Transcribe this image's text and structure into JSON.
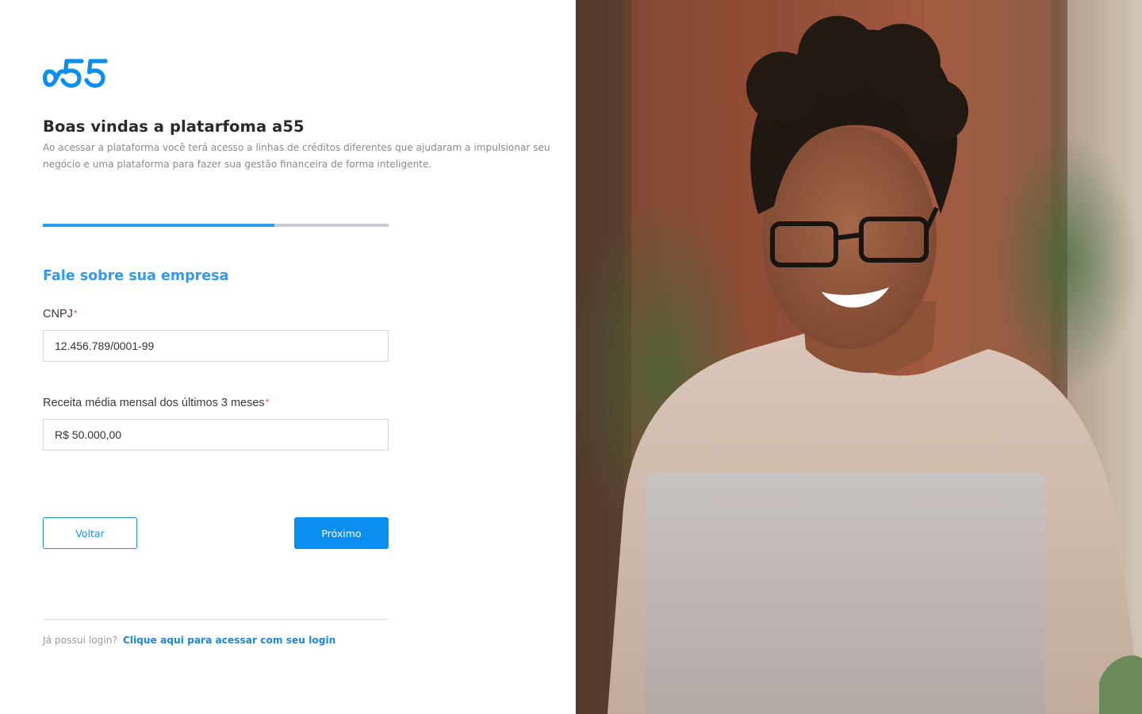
{
  "brand": {
    "logo_text": "a55",
    "accent": "#0a8ef0"
  },
  "welcome": {
    "title": "Boas vindas a platarfoma a55",
    "description": "Ao acessar a plataforma você terá acesso a linhas de créditos diferentes que ajudaram a impulsionar seu negócio e uma plataforma para fazer sua gestão financeira de forma inteligente."
  },
  "progress": {
    "fraction": 0.67
  },
  "form": {
    "section_title": "Fale sobre sua empresa",
    "cnpj": {
      "label": "CNPJ",
      "required_mark": "*",
      "value": "12.456.789/0001-99"
    },
    "revenue": {
      "label": "Receita média mensal dos últimos 3 meses",
      "required_mark": "*",
      "value": "R$ 50.000,00"
    }
  },
  "actions": {
    "back_label": "Voltar",
    "next_label": "Próximo"
  },
  "footer": {
    "prompt": "Já possui login?",
    "link_label": "Clique aqui para acessar com seu login"
  },
  "hero": {
    "image": "smiling-woman-with-laptop-photo"
  }
}
